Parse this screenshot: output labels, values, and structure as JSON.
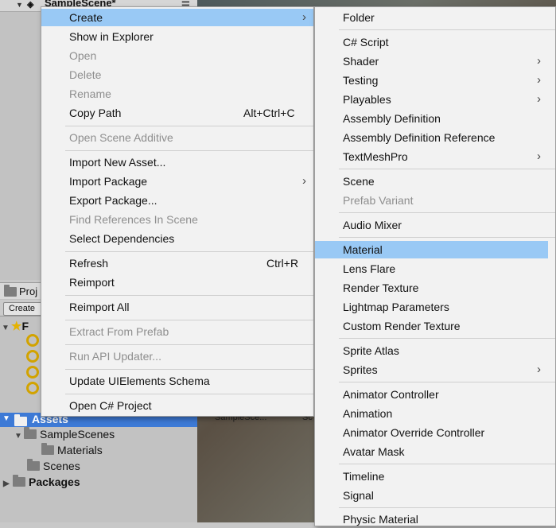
{
  "hierarchy": {
    "scene_label": "SampleScene*"
  },
  "project": {
    "tab_label": "Proj",
    "create_label": "Create",
    "favorites_label": "F",
    "assets_label": "Assets",
    "tree": [
      {
        "label": "SampleScenes"
      },
      {
        "label": "Materials"
      },
      {
        "label": "Scenes"
      },
      {
        "label": "Packages"
      }
    ],
    "grid_label": "SampleSce...",
    "grid_label2": "Sc"
  },
  "context_menu": {
    "items": [
      {
        "label": "Create",
        "has_submenu": true,
        "highlighted": true
      },
      {
        "label": "Show in Explorer"
      },
      {
        "label": "Open",
        "disabled": true
      },
      {
        "label": "Delete",
        "disabled": true
      },
      {
        "label": "Rename",
        "disabled": true
      },
      {
        "label": "Copy Path",
        "shortcut": "Alt+Ctrl+C"
      },
      {
        "label": "Open Scene Additive",
        "disabled": true
      },
      {
        "label": "Import New Asset..."
      },
      {
        "label": "Import Package",
        "has_submenu": true
      },
      {
        "label": "Export Package..."
      },
      {
        "label": "Find References In Scene",
        "disabled": true
      },
      {
        "label": "Select Dependencies"
      },
      {
        "label": "Refresh",
        "shortcut": "Ctrl+R"
      },
      {
        "label": "Reimport"
      },
      {
        "label": "Reimport All"
      },
      {
        "label": "Extract From Prefab",
        "disabled": true
      },
      {
        "label": "Run API Updater...",
        "disabled": true
      },
      {
        "label": "Update UIElements Schema"
      },
      {
        "label": "Open C# Project"
      }
    ]
  },
  "create_submenu": {
    "items": [
      {
        "label": "Folder"
      },
      {
        "label": "C# Script"
      },
      {
        "label": "Shader",
        "has_submenu": true
      },
      {
        "label": "Testing",
        "has_submenu": true
      },
      {
        "label": "Playables",
        "has_submenu": true
      },
      {
        "label": "Assembly Definition"
      },
      {
        "label": "Assembly Definition Reference"
      },
      {
        "label": "TextMeshPro",
        "has_submenu": true
      },
      {
        "label": "Scene"
      },
      {
        "label": "Prefab Variant",
        "disabled": true
      },
      {
        "label": "Audio Mixer"
      },
      {
        "label": "Material",
        "highlighted": true
      },
      {
        "label": "Lens Flare"
      },
      {
        "label": "Render Texture"
      },
      {
        "label": "Lightmap Parameters"
      },
      {
        "label": "Custom Render Texture"
      },
      {
        "label": "Sprite Atlas"
      },
      {
        "label": "Sprites",
        "has_submenu": true
      },
      {
        "label": "Animator Controller"
      },
      {
        "label": "Animation"
      },
      {
        "label": "Animator Override Controller"
      },
      {
        "label": "Avatar Mask"
      },
      {
        "label": "Timeline"
      },
      {
        "label": "Signal"
      },
      {
        "label": "Physic Material"
      }
    ]
  },
  "colors": {
    "highlight": "#99c9f5",
    "selection_blue": "#3d7ad6",
    "disabled_text": "#8e8e8e",
    "menu_bg": "#f2f2f2"
  }
}
